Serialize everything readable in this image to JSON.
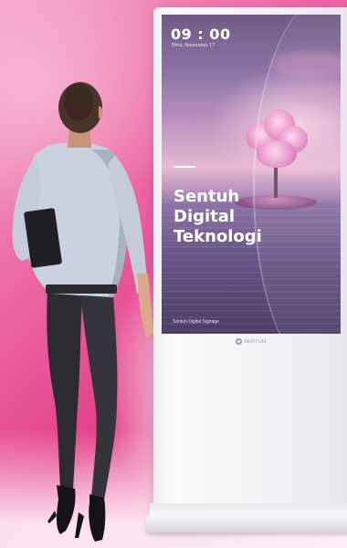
{
  "kiosk": {
    "screen": {
      "time": "09 : 00",
      "date": "Wed, November 17",
      "headline_lines": [
        "Sentuh",
        "Digital",
        "Teknologi"
      ],
      "caption": "Sentuh Digital Signage"
    },
    "brand_label": "SENTUH",
    "brand_icon": "logo-icon"
  },
  "colors": {
    "background_accent": "#e24088",
    "screen_text": "#ffffff"
  }
}
